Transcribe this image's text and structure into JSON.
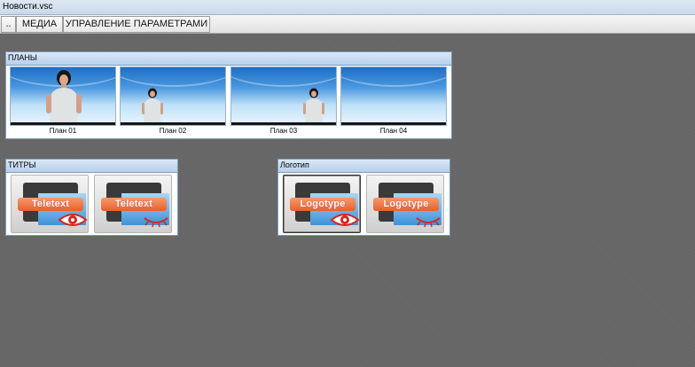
{
  "window": {
    "title": "Новости.vsc"
  },
  "menu": {
    "back_label": "..",
    "media_label": "МЕДИА",
    "params_label": "УПРАВЛЕНИЕ ПАРАМЕТРАМИ"
  },
  "plans_panel": {
    "title": "ПЛАНЫ",
    "items": [
      {
        "label": "План 01"
      },
      {
        "label": "План 02"
      },
      {
        "label": "План 03"
      },
      {
        "label": "План 04"
      }
    ]
  },
  "titles_panel": {
    "title": "ТИТРЫ",
    "items": [
      {
        "label": "Teletext",
        "icon": "eye-icon"
      },
      {
        "label": "Teletext",
        "icon": "closed-eye-icon"
      }
    ]
  },
  "logo_panel": {
    "title": "Логотип",
    "items": [
      {
        "label": "Logotype",
        "icon": "eye-icon",
        "selected": true
      },
      {
        "label": "Logotype",
        "icon": "closed-eye-icon"
      }
    ]
  },
  "colors": {
    "accent_orange": "#e8602e",
    "workspace_bg": "#666666",
    "panel_border": "#7f9db9"
  }
}
